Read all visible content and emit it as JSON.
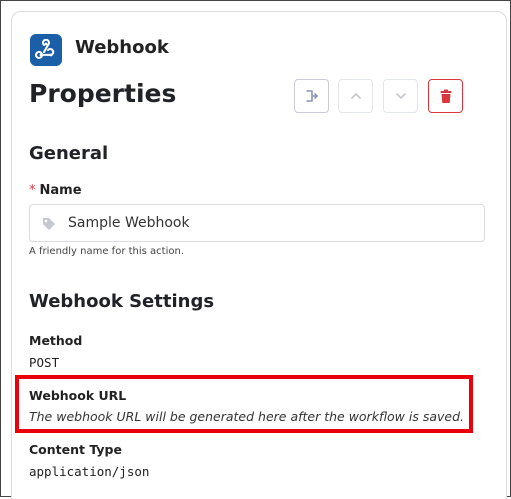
{
  "header": {
    "app_name": "Webhook",
    "app_icon": "webhook-icon",
    "brand_color": "#1a5fa8"
  },
  "page_title": "Properties",
  "toolbar": {
    "buttons": [
      {
        "name": "branch-button",
        "icon": "branch-icon"
      },
      {
        "name": "move-up-button",
        "icon": "chevron-up-icon"
      },
      {
        "name": "move-down-button",
        "icon": "chevron-down-icon"
      },
      {
        "name": "delete-button",
        "icon": "trash-icon",
        "color": "#d9363e"
      }
    ]
  },
  "general": {
    "title": "General",
    "name_field": {
      "required_mark": "*",
      "label": "Name",
      "value": "Sample Webhook",
      "icon": "tag-icon",
      "hint": "A friendly name for this action."
    }
  },
  "webhook_settings": {
    "title": "Webhook Settings",
    "method": {
      "label": "Method",
      "value": "POST"
    },
    "url": {
      "label": "Webhook URL",
      "value": "The webhook URL will be generated here after the workflow is saved."
    },
    "content_type": {
      "label": "Content Type",
      "value": "application/json"
    }
  },
  "annotation": {
    "highlight_color": "#e8000b"
  }
}
